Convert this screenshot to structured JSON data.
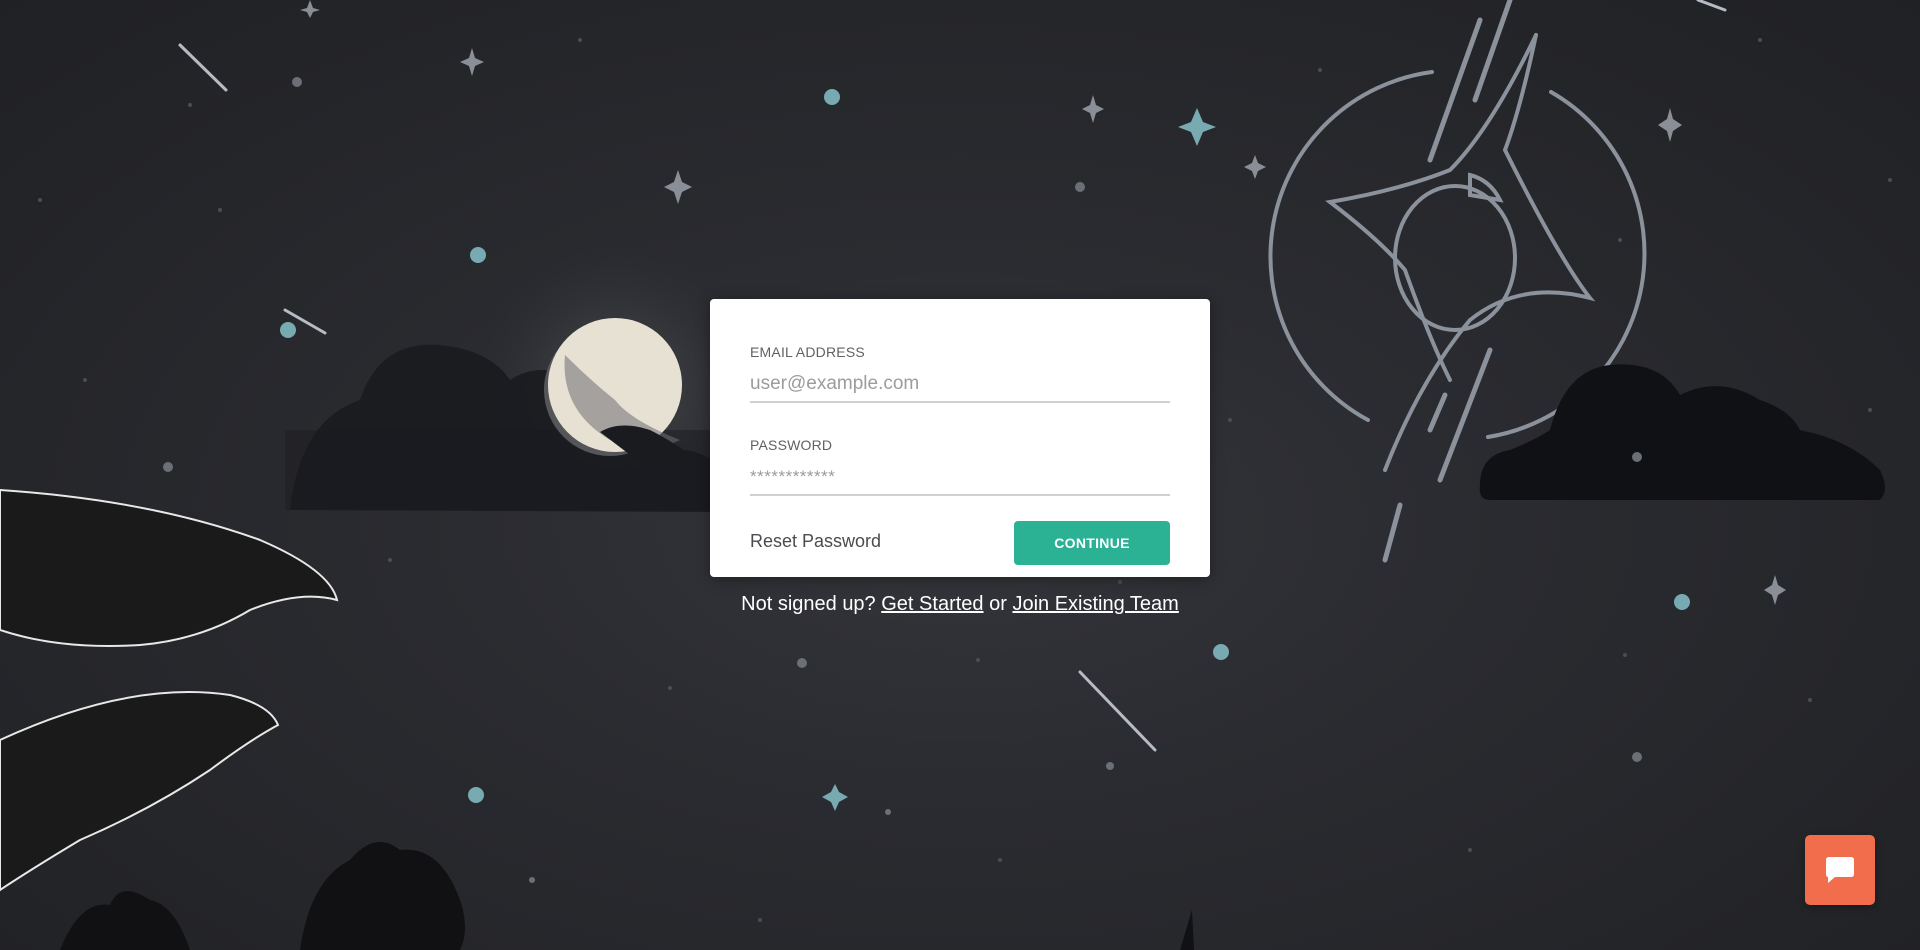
{
  "login": {
    "email_label": "EMAIL ADDRESS",
    "email_placeholder": "user@example.com",
    "password_label": "PASSWORD",
    "password_placeholder": "************",
    "reset_link": "Reset Password",
    "continue_label": "CONTINUE"
  },
  "signup": {
    "prompt": "Not signed up?",
    "get_started": "Get Started",
    "separator": "or",
    "join_team": "Join Existing Team"
  },
  "chat": {
    "icon": "chat-bubble-icon"
  },
  "colors": {
    "accent": "#2bb193",
    "chat_button": "#f26d4c",
    "background": "#26272c"
  }
}
